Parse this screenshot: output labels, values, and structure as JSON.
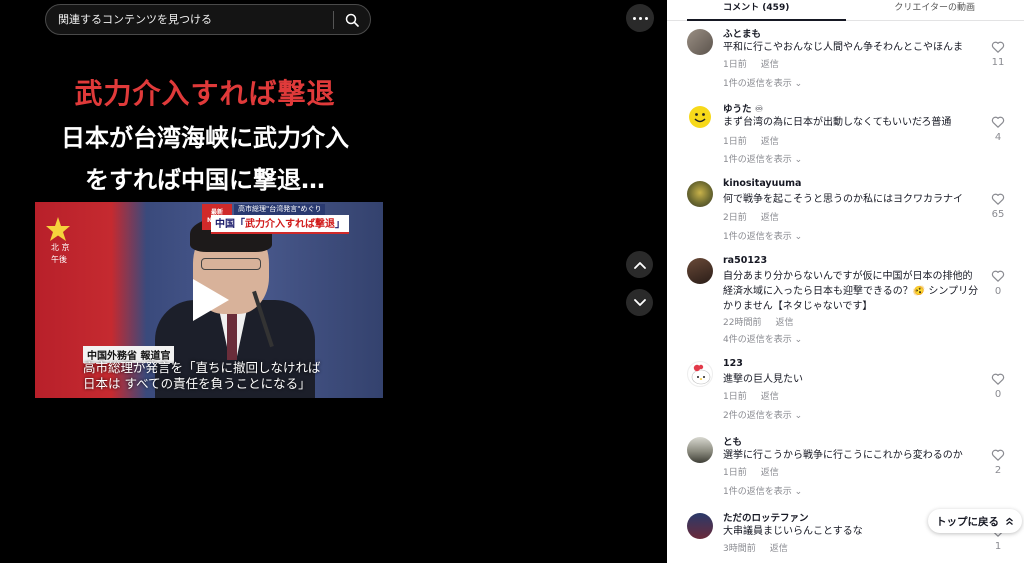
{
  "search": {
    "placeholder": "関連するコンテンツを見つける"
  },
  "video": {
    "headline_red": "武力介入すれば撃退",
    "headline_line1": "日本が台湾海峡に武力介入",
    "headline_line2": "をすれば中国に撃退…",
    "frame": {
      "location_line1": "北 京",
      "location_line2": "午後",
      "news_badge_line1": "最新",
      "news_badge_line2": "NEWS",
      "news_small": "高市総理\"台湾発言\"めぐり",
      "news_big_prefix": "中国「",
      "news_big_highlight": "武力介入すれば撃退",
      "news_big_suffix": "」",
      "speaker_label": "中国外務省 報道官",
      "subtitle_line1": "高市総理が発言を「直ちに撤回しなければ",
      "subtitle_line2": "日本は すべての責任を負うことになる」"
    }
  },
  "tabs": {
    "comments": "コメント (459)",
    "creator_videos": "クリエイターの動画"
  },
  "comments": [
    {
      "user": "ふとまも",
      "text": "平和に行こやおんなじ人間やん争そわんとこやほんま",
      "time": "1日前",
      "reply": "返信",
      "likes": "11",
      "view_replies": "1件の返信を表示"
    },
    {
      "user": "ゆうた ♾",
      "text": "まず台湾の為に日本が出動しなくてもいいだろ普通",
      "time": "1日前",
      "reply": "返信",
      "likes": "4",
      "view_replies": "1件の返信を表示"
    },
    {
      "user": "kinositayuuma",
      "text": "何で戦争を起こそうと思うのか私にはヨクワカラナイ",
      "time": "2日前",
      "reply": "返信",
      "likes": "65",
      "view_replies": "1件の返信を表示"
    },
    {
      "user": "ra50123",
      "text": "自分あまり分からないんですが仮に中国が日本の排他的経済水域に入ったら日本も迎撃できるの？🫨 シンプリ分かりません【ネタじゃないです】",
      "time": "22時間前",
      "reply": "返信",
      "likes": "0",
      "view_replies": "4件の返信を表示"
    },
    {
      "user": "123",
      "text": "進撃の巨人見たい",
      "time": "1日前",
      "reply": "返信",
      "likes": "0",
      "view_replies": "2件の返信を表示"
    },
    {
      "user": "とも",
      "text": "選挙に行こうから戦争に行こうにこれから変わるのか",
      "time": "1日前",
      "reply": "返信",
      "likes": "2",
      "view_replies": "1件の返信を表示"
    },
    {
      "user": "ただのロッテファン",
      "text": "大串議員まじいらんことするな",
      "time": "3時間前",
      "reply": "返信",
      "likes": "1",
      "view_replies": ""
    }
  ],
  "back_to_top": "トップに戻る"
}
